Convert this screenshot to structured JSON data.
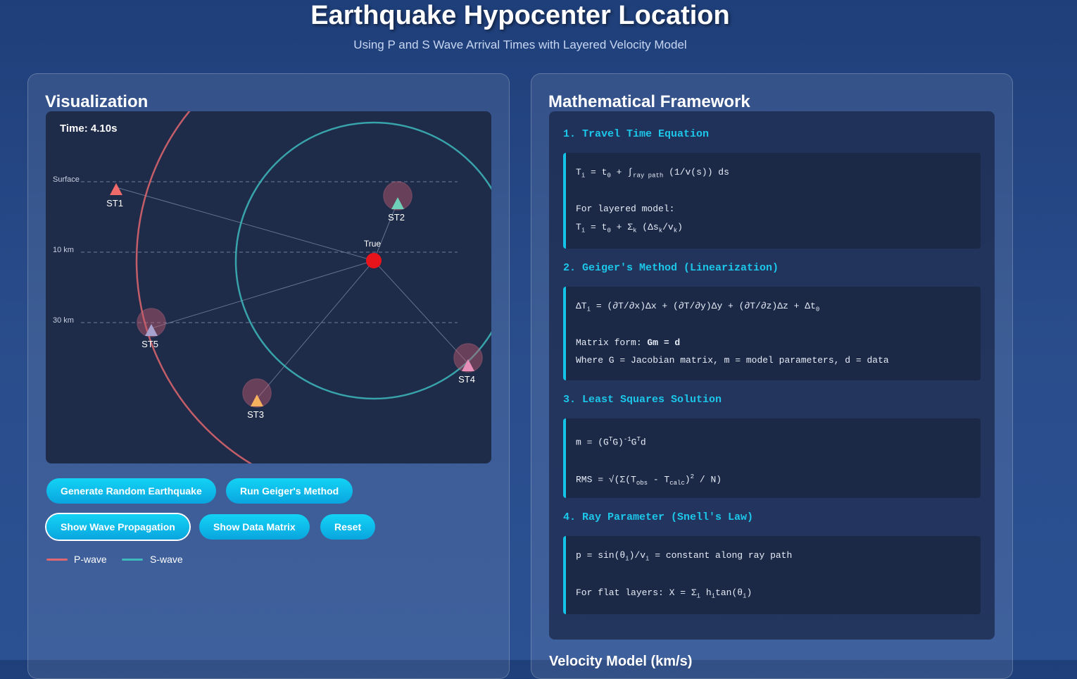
{
  "header": {
    "title": "Earthquake Hypocenter Location",
    "subtitle": "Using P and S Wave Arrival Times with Layered Velocity Model"
  },
  "visualization": {
    "heading": "Visualization",
    "time_label": "Time: 4.10s",
    "depth_labels": [
      "Surface",
      "10 km",
      "30 km"
    ],
    "epicenter_label": "True",
    "stations": [
      "ST1",
      "ST2",
      "ST3",
      "ST4",
      "ST5"
    ],
    "colors": {
      "background": "#1e2b49",
      "p_wave": "#e0676f",
      "s_wave": "#3db9bb",
      "epicenter": "#e8141c",
      "st1": "#f06a6a",
      "st2": "#6ed0b8",
      "st3": "#f6b15e",
      "st4": "#e78fb8",
      "st5": "#a8a2cf"
    }
  },
  "controls": {
    "generate": "Generate Random Earthquake",
    "geiger": "Run Geiger's Method",
    "propagation": "Show Wave Propagation",
    "matrix": "Show Data Matrix",
    "reset": "Reset"
  },
  "legend": {
    "p_wave": "P-wave",
    "s_wave": "S-wave"
  },
  "framework": {
    "heading": "Mathematical Framework",
    "s1_title": "1. Travel Time Equation",
    "s1_layered": "For layered model:",
    "s2_title": "2. Geiger's Method (Linearization)",
    "s2_matrix_prefix": "Matrix form: ",
    "s2_matrix_bold": "Gm = d",
    "s2_where": "Where G = Jacobian matrix, m = model parameters, d = data",
    "s3_title": "3. Least Squares Solution",
    "s4_title": "4. Ray Parameter (Snell's Law)",
    "s4_line1_suffix": " = constant along ray path",
    "velocity_heading": "Velocity Model (km/s)"
  }
}
